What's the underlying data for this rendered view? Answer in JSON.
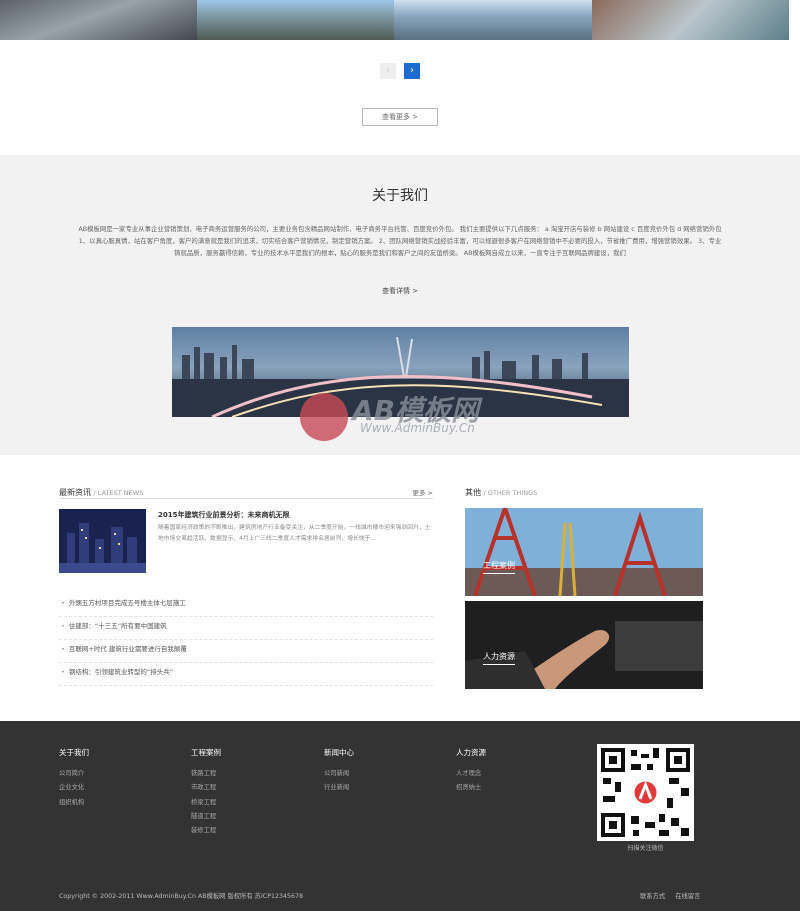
{
  "slider": {
    "prev_icon": "‹",
    "next_icon": "›",
    "more_label": "查看更多 >"
  },
  "about": {
    "title": "关于我们",
    "text": "AB模板网是一家专业从事企业营销策划、电子商务运营服务的公司，主要业务包含精品网站制作、电子商务平台托管、百度竞价外包。 我们主要提供以下几点服务： a 淘宝开店与装修 b 网站建设 c 百度竞价外包 d 网络营销外包 1、以真心服真情，站在客户角度，客户的满意就是我们的追求，切实结合客户营销情况，制定营销方案。 2、团队网络营销实战经验丰富，可以规避很多客户在网络营销中不必要的投入，节省推广费用，增强营销效果。 3、专业铸就品质，服务赢得信赖，专业的技术水平是我们的根本，贴心的服务是我们和客户之间的友谊桥梁。 AB模板网自成立以来，一直专注于互联网品牌建设，我们",
    "more_label": "查看详情 >"
  },
  "watermark": {
    "text": "AB模板网",
    "url": "Www.AdminBuy.Cn"
  },
  "news": {
    "title": "最新资讯",
    "subtitle": "/ LATEST NEWS",
    "more_label": "更多 >",
    "featured": {
      "title": "2015年建筑行业前景分析：未来商机无限",
      "desc": "随着国家经济政策的不断推出，建筑房地产行业备受关注，从二季度开始，一线城市楼市迎来强劲回升，土地市场交易趋活跃。数据显示，4月上广三线二季度人才需求排名居前列，增长快于..."
    },
    "items": [
      "外甥五方村项目完成五号楼主体七层施工",
      "住建部：“十三五”所有要中国建筑",
      "互联网+时代 建筑行业需要进行自我颠覆",
      "钢结构：引领建筑业转型的“排头兵”"
    ]
  },
  "other": {
    "title": "其他",
    "subtitle": "/ OTHER THINGS",
    "cards": [
      "工程案例",
      "人力资源"
    ]
  },
  "footer": {
    "columns": [
      {
        "heading": "关于我们",
        "links": [
          "公司简介",
          "企业文化",
          "组织机构"
        ]
      },
      {
        "heading": "工程案例",
        "links": [
          "铁路工程",
          "市政工程",
          "桥梁工程",
          "隧道工程",
          "装修工程"
        ]
      },
      {
        "heading": "新闻中心",
        "links": [
          "公司新闻",
          "行业新闻"
        ]
      },
      {
        "heading": "人力资源",
        "links": [
          "人才理念",
          "招贤纳士"
        ]
      }
    ],
    "qr_caption": "扫描关注微信",
    "copyright": "Copyright © 2002-2011 Www.AdminBuy.Cn AB模板网 版权所有  苏ICP12345678",
    "links": [
      "联系方式",
      "在线留言"
    ]
  }
}
